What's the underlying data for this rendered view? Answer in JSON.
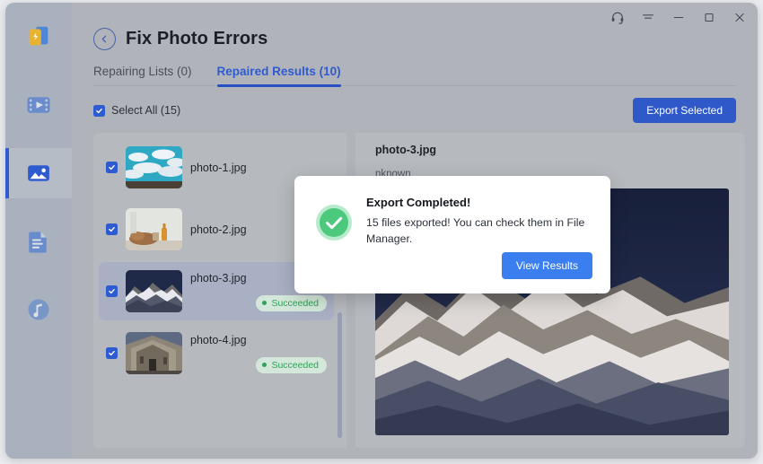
{
  "window": {
    "controls": [
      {
        "name": "headset-icon",
        "label": "Support"
      },
      {
        "name": "menu-icon",
        "label": "Menu"
      },
      {
        "name": "minimize-icon",
        "label": "Minimize"
      },
      {
        "name": "maximize-icon",
        "label": "Maximize"
      },
      {
        "name": "close-icon",
        "label": "Close"
      }
    ]
  },
  "sidebar": {
    "logo": "app-logo",
    "items": [
      {
        "icon": "video-icon",
        "label": "Video",
        "active": false
      },
      {
        "icon": "image-icon",
        "label": "Photo",
        "active": true
      },
      {
        "icon": "document-icon",
        "label": "Document",
        "active": false
      },
      {
        "icon": "music-icon",
        "label": "Audio",
        "active": false
      }
    ]
  },
  "header": {
    "back_icon": "chevron-left-icon",
    "title": "Fix Photo Errors"
  },
  "tabs": [
    {
      "label": "Repairing Lists (0)",
      "active": false
    },
    {
      "label": "Repaired Results (10)",
      "active": true
    }
  ],
  "toolbar": {
    "select_all_label": "Select All (15)",
    "select_all_checked": true,
    "export_label": "Export Selected"
  },
  "list": [
    {
      "name": "photo-1.jpg",
      "checked": true,
      "status": "",
      "selected": false,
      "thumb": "clouds"
    },
    {
      "name": "photo-2.jpg",
      "checked": true,
      "status": "",
      "selected": false,
      "thumb": "still-life"
    },
    {
      "name": "photo-3.jpg",
      "checked": true,
      "status": "Succeeded",
      "selected": true,
      "thumb": "mountain"
    },
    {
      "name": "photo-4.jpg",
      "checked": true,
      "status": "Succeeded",
      "selected": false,
      "thumb": "building"
    }
  ],
  "preview": {
    "title": "photo-3.jpg",
    "meta": "nknown"
  },
  "modal": {
    "icon": "success-check-icon",
    "title": "Export Completed!",
    "text": "15 files exported! You can check them in File Manager.",
    "button_label": "View Results"
  },
  "colors": {
    "accent": "#2f5bd0",
    "modal_button": "#3b7ef0",
    "success": "#34a05b",
    "window_bg": "#b0b4ba",
    "sidebar_bg": "#a8b1bd"
  }
}
